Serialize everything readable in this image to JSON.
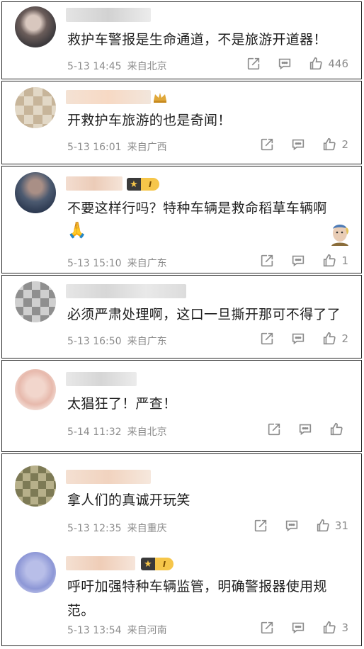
{
  "comments": [
    {
      "text": "救护车警报是生命通道，不是旅游开道器！",
      "date": "5-13 14:45",
      "location": "来自北京",
      "likes": "446"
    },
    {
      "text": "开救护车旅游的也是奇闻！",
      "date": "5-13 16:01",
      "location": "来自广西",
      "likes": "2"
    },
    {
      "text": "不要这样行吗？特种车辆是救命稻草车辆啊",
      "date": "5-13 15:10",
      "location": "来自广东",
      "likes": "1",
      "badge_level": "I"
    },
    {
      "text": "必须严肃处理啊，这口一旦撕开那可不得了了",
      "date": "5-13 16:50",
      "location": "来自广东",
      "likes": "2"
    },
    {
      "text": "太猖狂了！严查！",
      "date": "5-14 11:32",
      "location": "来自北京",
      "likes": ""
    },
    {
      "text": "拿人们的真诚开玩笑",
      "date": "5-13 12:35",
      "location": "来自重庆",
      "likes": "31"
    },
    {
      "text": "呼吁加强特种车辆监管，明确警报器使用规范。",
      "date": "5-13 13:54",
      "location": "来自河南",
      "likes": "3",
      "badge_level": "I"
    }
  ],
  "icons": {
    "emoji": "🙏",
    "star": "★"
  },
  "colors": {
    "text": "#1f1f1f",
    "meta": "#8c8c8c",
    "border": "#2a2a2a",
    "vip_gold": "#f6c64a"
  }
}
